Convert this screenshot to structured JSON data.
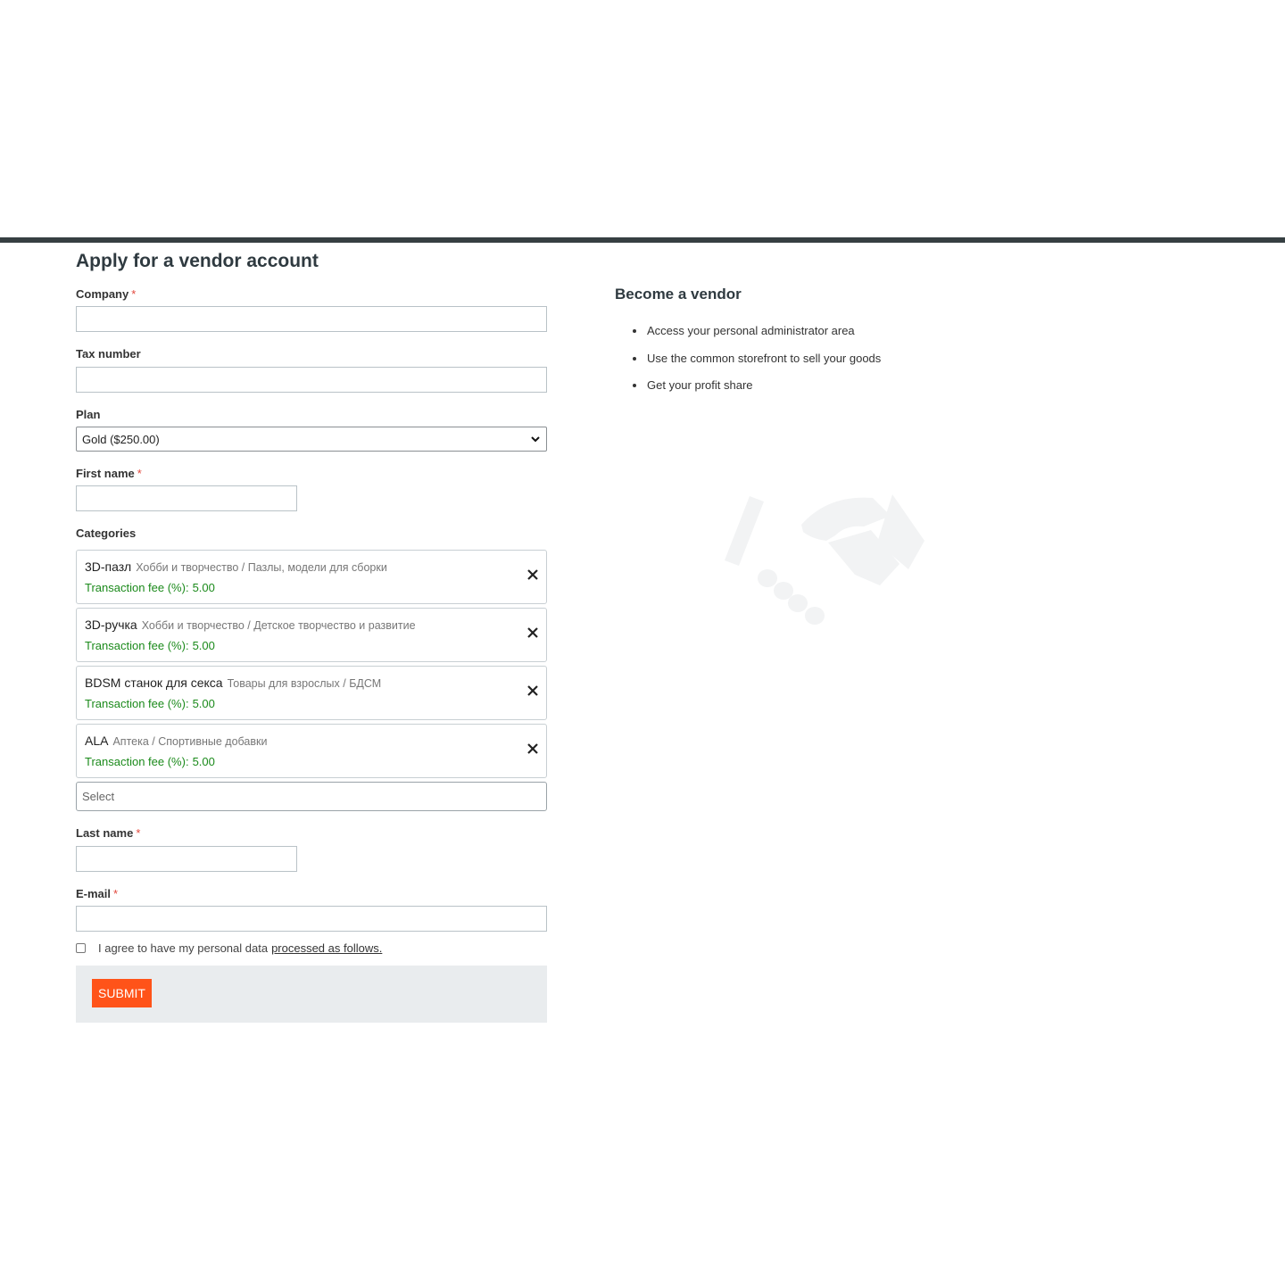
{
  "page": {
    "title": "Apply for a vendor account"
  },
  "form": {
    "company_label": "Company",
    "tax_label": "Tax number",
    "plan_label": "Plan",
    "plan_value": "Gold ($250.00)",
    "first_name_label": "First name",
    "categories_label": "Categories",
    "categories": [
      {
        "name": "3D-пазл",
        "path": "Хобби и творчество / Пазлы, модели для сборки",
        "fee_label": "Transaction fee (%):",
        "fee_value": "5.00"
      },
      {
        "name": "3D-ручка",
        "path": "Хобби и творчество / Детское творчество и развитие",
        "fee_label": "Transaction fee (%):",
        "fee_value": "5.00"
      },
      {
        "name": "BDSM станок для секса",
        "path": "Товары для взрослых / БДСМ",
        "fee_label": "Transaction fee (%):",
        "fee_value": "5.00"
      },
      {
        "name": "ALA",
        "path": "Аптека / Спортивные добавки",
        "fee_label": "Transaction fee (%):",
        "fee_value": "5.00"
      }
    ],
    "category_select_placeholder": "Select",
    "last_name_label": "Last name",
    "email_label": "E-mail",
    "required_mark": "*",
    "agree_text": "I agree to have my personal data",
    "agree_link": "processed as follows.",
    "submit_label": "SUBMIT"
  },
  "sidebar": {
    "title": "Become a vendor",
    "benefits": [
      "Access your personal administrator area",
      "Use the common storefront to sell your goods",
      "Get your profit share"
    ],
    "illustration": "handshake-icon"
  },
  "colors": {
    "accent": "#ff5319",
    "fee_green": "#1b8a1b",
    "required_red": "#e2483d",
    "top_bar": "#363f42"
  }
}
